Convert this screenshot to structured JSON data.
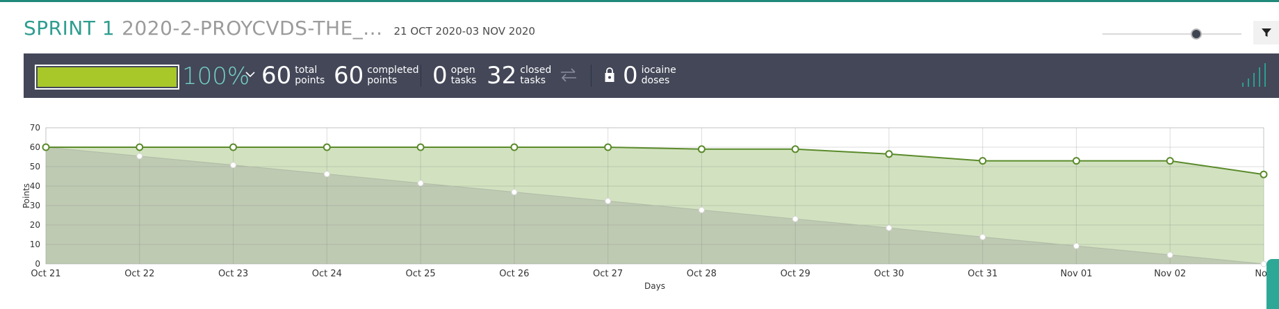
{
  "header": {
    "sprint_name": "SPRINT 1",
    "project_name": "2020-2-PROYCVDS-THE_...",
    "date_range": "21 OCT 2020-03 NOV 2020"
  },
  "controls": {
    "zoom_level": 0.69,
    "filter_icon": "funnel-icon"
  },
  "summary": {
    "progress_percent": 100,
    "progress_text": "100%",
    "total_points": {
      "value": "60",
      "label_line1": "total",
      "label_line2": "points"
    },
    "completed_points": {
      "value": "60",
      "label_line1": "completed",
      "label_line2": "points"
    },
    "open_tasks": {
      "value": "0",
      "label_line1": "open",
      "label_line2": "tasks"
    },
    "closed_tasks": {
      "value": "32",
      "label_line1": "closed",
      "label_line2": "tasks"
    },
    "iocaine_doses": {
      "value": "0",
      "label_line1": "iocaine",
      "label_line2": "doses"
    },
    "colors": {
      "bar_bg": "#434758",
      "progress_fill": "#a8c729",
      "percent_text": "#74d0c5"
    }
  },
  "chart_data": {
    "type": "area",
    "xlabel": "Days",
    "ylabel": "Points",
    "ylim": [
      0,
      70
    ],
    "yticks": [
      0,
      10,
      20,
      30,
      40,
      50,
      60,
      70
    ],
    "categories": [
      "Oct 21",
      "Oct 22",
      "Oct 23",
      "Oct 24",
      "Oct 25",
      "Oct 26",
      "Oct 27",
      "Oct 28",
      "Oct 29",
      "Oct 30",
      "Oct 31",
      "Nov 01",
      "Nov 02",
      "Nov"
    ],
    "series": [
      {
        "values": [
          60,
          60,
          60,
          60,
          60,
          60,
          60,
          59,
          59,
          56.5,
          53,
          53,
          53,
          46
        ],
        "color": "#5a8a2a",
        "fill": "#d2e2c0"
      },
      {
        "values": [
          60,
          55.4,
          50.8,
          46.2,
          41.5,
          36.9,
          32.3,
          27.7,
          23.1,
          18.5,
          13.8,
          9.2,
          4.6,
          0
        ],
        "color": "#b3bda8",
        "fill": "#bfcab3"
      }
    ],
    "grid": true,
    "legend": "none"
  }
}
